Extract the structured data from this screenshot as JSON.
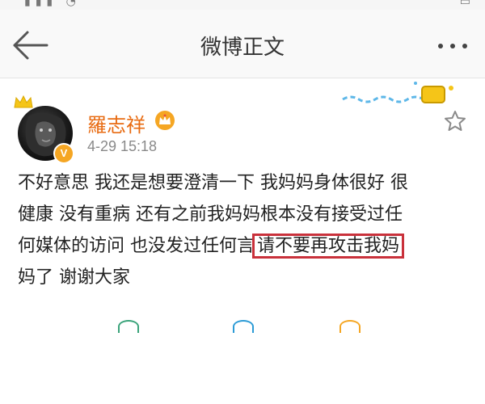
{
  "header": {
    "title": "微博正文"
  },
  "post": {
    "author": {
      "name": "羅志祥",
      "verified_badge": "V",
      "name_color": "#e86b12"
    },
    "timestamp": "4-29 15:18",
    "content_lines": [
      "不好意思 我还是想要澄清一下 我妈妈身体很好 很",
      "健康 没有重病 还有之前我妈妈根本没有接受过任",
      "何媒体的访问 也没发过任何言",
      "请不要再攻击我妈",
      "妈了 谢谢大家"
    ],
    "highlight_color": "#c9313b"
  },
  "icons": {
    "back": "back-arrow-icon",
    "more": "more-dots-icon",
    "vip": "crown-icon",
    "favorite": "star-icon"
  }
}
